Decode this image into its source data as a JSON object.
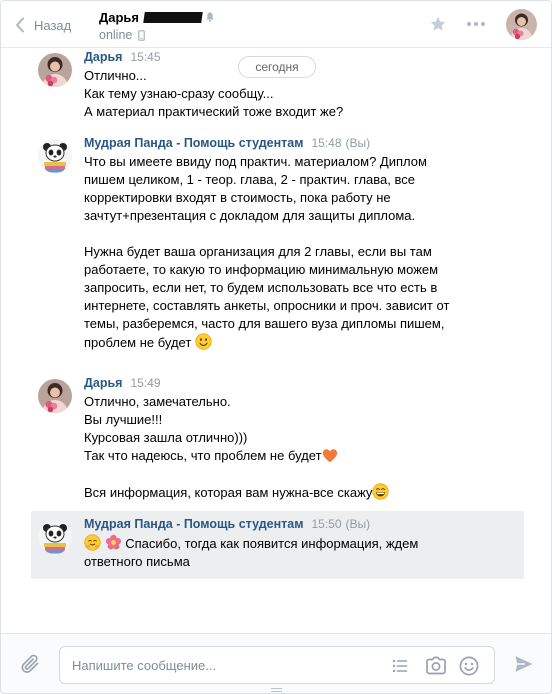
{
  "header": {
    "back_label": "Назад",
    "contact_name": "Дарья",
    "status": "online"
  },
  "date_separator": "сегодня",
  "messages": [
    {
      "author": "Дарья",
      "time": "15:45",
      "lines": [
        "Отлично...",
        "Как тему узнаю-сразу сообщу...",
        "А материал практический тоже входит же?"
      ]
    },
    {
      "author": "Мудрая Панда - Помощь студентам",
      "time": "15:48",
      "own_mark": "(Вы)",
      "lines": [
        "Что вы имеете ввиду под практич. материалом? Диплом",
        "пишем целиком, 1 - теор. глава, 2 - практич. глава, все",
        "корректировки входят в стоимость, пока работу не",
        "зачтут+презентация с докладом для защиты диплома.",
        "",
        "Нужна будет ваша организация для 2 главы, если вы там",
        "работаете, то какую то информацию минимальную можем",
        "запросить, если нет, то будем использовать все что есть в",
        "интернете, составлять анкеты, опросники и проч. зависит от",
        "темы, разберемся, часто для вашего вуза дипломы пишем,",
        "проблем не будет"
      ]
    },
    {
      "author": "Дарья",
      "time": "15:49",
      "lines": [
        "Отлично, замечательно.",
        "Вы лучшие!!!",
        "Курсовая зашла отлично)))",
        "Так что надеюсь, что проблем не будет",
        "",
        "Вся информация, которая вам нужна-все скажу"
      ]
    },
    {
      "author": "Мудрая Панда - Помощь студентам",
      "time": "15:50",
      "own_mark": "(Вы)",
      "lines": [
        "Спасибо, тогда как появится информация, ждем",
        "ответного письма"
      ]
    }
  ],
  "composer": {
    "placeholder": "Напишите сообщение..."
  },
  "icons": {
    "back": "chevron-left-icon",
    "favorite": "star-icon",
    "more": "more-dots-icon",
    "attach": "paperclip-icon",
    "templates": "list-icon",
    "camera": "camera-icon",
    "emoji": "smile-icon",
    "send": "send-arrow-icon"
  },
  "colors": {
    "link": "#2a5885",
    "muted": "#818c99",
    "selected_bg": "#edeef0",
    "border": "#dce1e6"
  }
}
